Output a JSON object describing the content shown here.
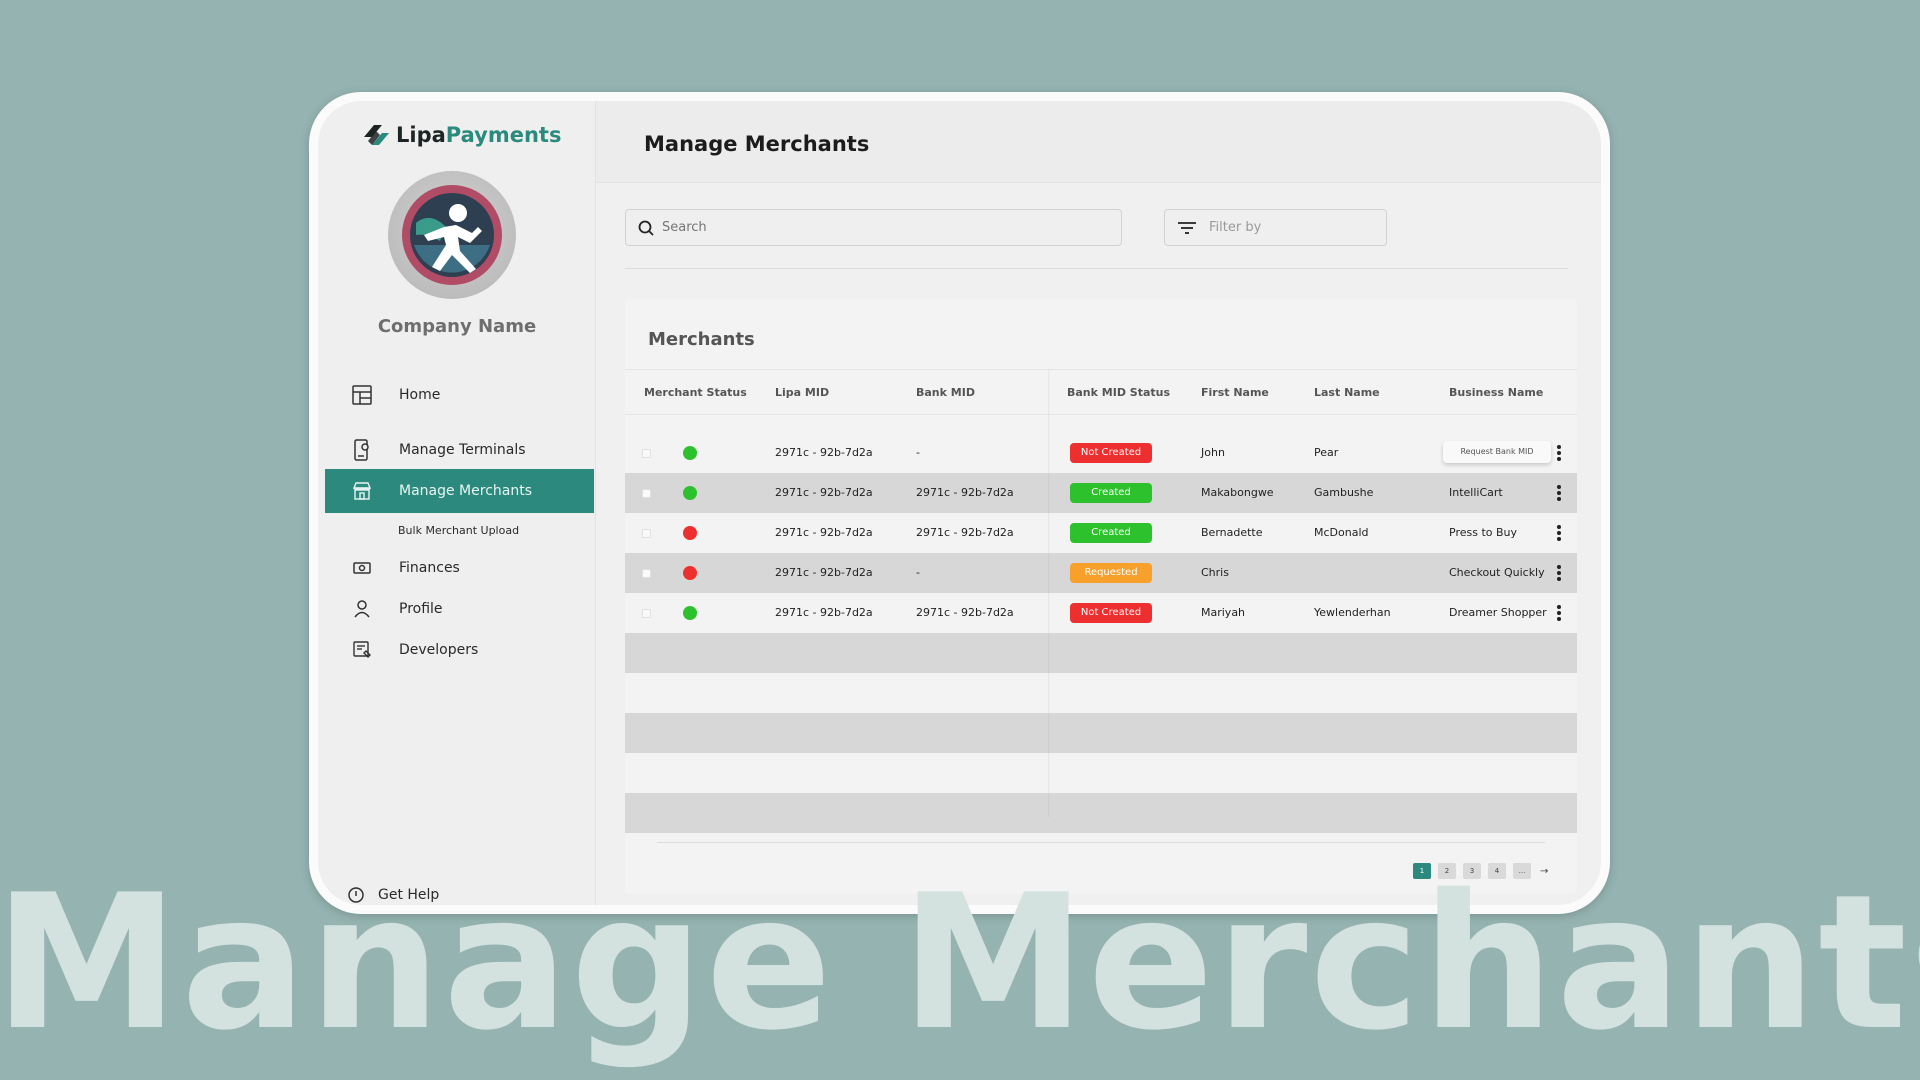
{
  "brand": {
    "part1": "Lipa",
    "part2": "Payments"
  },
  "sidebar": {
    "company_name": "Company Name",
    "items": [
      {
        "label": "Home",
        "icon": "dashboard-icon"
      },
      {
        "label": "Manage Terminals",
        "icon": "terminal-icon"
      },
      {
        "label": "Manage Merchants",
        "icon": "store-icon",
        "active": true
      },
      {
        "label": "Finances",
        "icon": "money-icon"
      },
      {
        "label": "Profile",
        "icon": "user-icon"
      },
      {
        "label": "Developers",
        "icon": "code-doc-icon"
      }
    ],
    "sub_item": "Bulk Merchant Upload",
    "help": "Get Help"
  },
  "header": {
    "title": "Manage Merchants"
  },
  "search": {
    "placeholder": "Search"
  },
  "filter": {
    "label": "Filter by"
  },
  "table": {
    "title": "Merchants",
    "columns": [
      "Merchant Status",
      "Lipa MID",
      "Bank MID",
      "Bank MID Status",
      "First Name",
      "Last Name",
      "Business Name"
    ],
    "rows": [
      {
        "status": "green",
        "lipa_mid": "2971c - 92b-7d2a",
        "bank_mid": "-",
        "bank_mid_status": "Not Created",
        "first_name": "John",
        "last_name": "Pear",
        "business_name": ""
      },
      {
        "status": "green",
        "lipa_mid": "2971c - 92b-7d2a",
        "bank_mid": "2971c - 92b-7d2a",
        "bank_mid_status": "Created",
        "first_name": "Makabongwe",
        "last_name": "Gambushe",
        "business_name": "IntelliCart"
      },
      {
        "status": "red",
        "lipa_mid": "2971c - 92b-7d2a",
        "bank_mid": "2971c - 92b-7d2a",
        "bank_mid_status": "Created",
        "first_name": "Bernadette",
        "last_name": "McDonald",
        "business_name": "Press to Buy"
      },
      {
        "status": "red",
        "lipa_mid": "2971c - 92b-7d2a",
        "bank_mid": "-",
        "bank_mid_status": "Requested",
        "first_name": "Chris",
        "last_name": "",
        "business_name": "Checkout Quickly"
      },
      {
        "status": "green",
        "lipa_mid": "2971c - 92b-7d2a",
        "bank_mid": "2971c - 92b-7d2a",
        "bank_mid_status": "Not Created",
        "first_name": "Mariyah",
        "last_name": "Yewlenderhan",
        "business_name": "Dreamer Shopper"
      }
    ],
    "row_menu_tooltip": "Request Bank MID"
  },
  "pagination": {
    "pages": [
      "1",
      "2",
      "3",
      "4",
      "..."
    ],
    "current": "1",
    "next": "→"
  },
  "watermark": "Manage Merchants",
  "colors": {
    "accent": "#2b8a7d",
    "status_green": "#2ec12e",
    "status_red": "#ee2f2f",
    "badge_not_created": "#ee2f2f",
    "badge_created": "#2ec12e",
    "badge_requested": "#f7a12c",
    "background": "#95b4b1"
  }
}
